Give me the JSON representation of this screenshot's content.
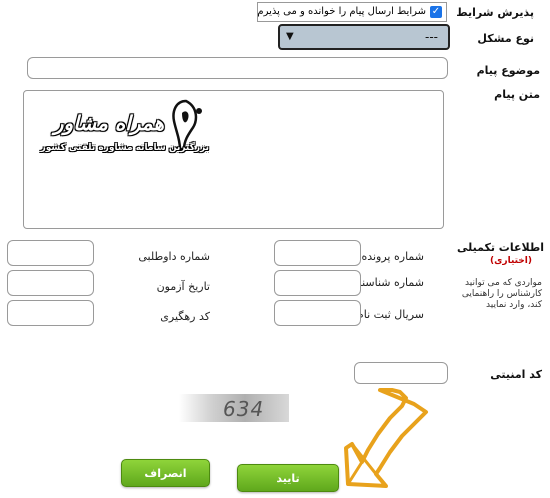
{
  "terms": {
    "label": "پذیرش شرایط",
    "checkbox_text": "شرایط ارسال پیام را خوانده و می پذیرم",
    "checked": true
  },
  "problem_type": {
    "label": "نوع مشکل",
    "selected": "---"
  },
  "subject": {
    "label": "موضوع پیام",
    "value": ""
  },
  "message": {
    "label": "متن پیام",
    "watermark_title": "همراه مشاور",
    "watermark_subtitle": "بزرگترین سامانه مشاوره تلفنی کشور"
  },
  "extra_info": {
    "title": "اطلاعات تکمیلی",
    "optional": "(اختیاری)",
    "note": "مواردی که می توانید کارشناس را راهنمایی کند، وارد نمایید",
    "fields": {
      "file_number": "شماره پرونده",
      "applicant_number": "شماره داوطلبی",
      "id_number": "شماره شناسنامه",
      "exam_date": "تاریخ آزمون",
      "registration_serial": "سریال ثبت نام",
      "tracking_code": "کد رهگیری"
    }
  },
  "security": {
    "label": "کد امنیتی",
    "value": ""
  },
  "captcha": {
    "text": "634"
  },
  "buttons": {
    "confirm": "تایید",
    "cancel": "انصراف"
  },
  "colors": {
    "accent_green": "#6bb820",
    "arrow_orange": "#e8a21c",
    "select_bg": "#b8c6d2"
  }
}
